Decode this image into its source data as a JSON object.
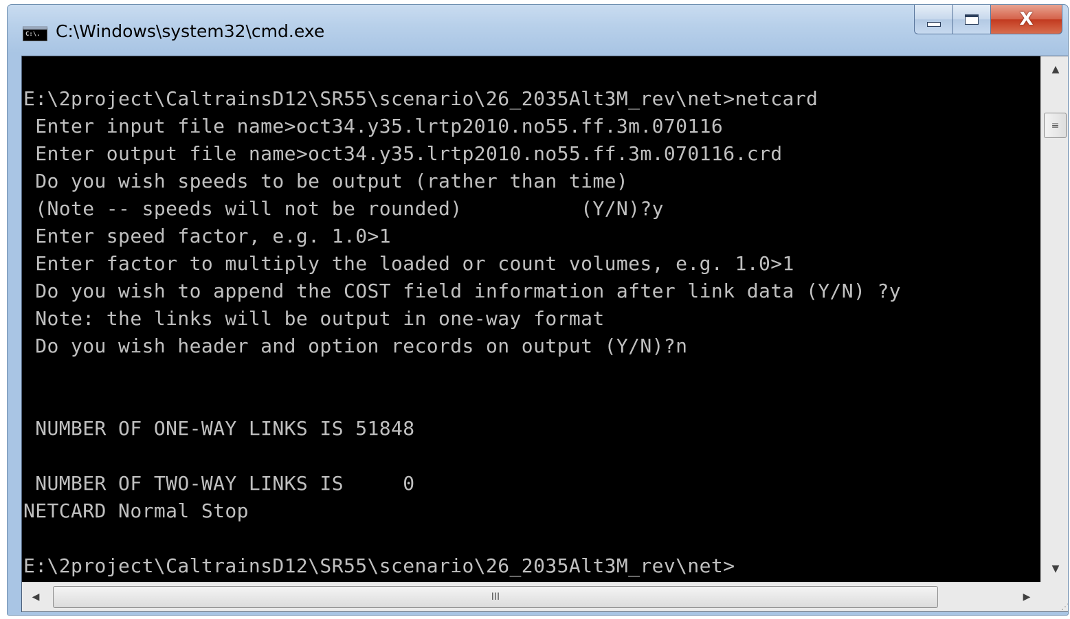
{
  "window": {
    "title": "C:\\Windows\\system32\\cmd.exe",
    "icon_text": "C:\\.",
    "icons": {
      "app": "cmd-prompt-icon",
      "minimize": "minimize-icon",
      "maximize": "maximize-icon",
      "close": "close-icon"
    },
    "close_glyph": "X"
  },
  "console": {
    "background": "#000000",
    "foreground": "#c0c0c0",
    "lines": [
      "E:\\2project\\CaltrainsD12\\SR55\\scenario\\26_2035Alt3M_rev\\net>netcard",
      " Enter input file name>oct34.y35.lrtp2010.no55.ff.3m.070116",
      " Enter output file name>oct34.y35.lrtp2010.no55.ff.3m.070116.crd",
      " Do you wish speeds to be output (rather than time)",
      " (Note -- speeds will not be rounded)          (Y/N)?y",
      " Enter speed factor, e.g. 1.0>1",
      " Enter factor to multiply the loaded or count volumes, e.g. 1.0>1",
      " Do you wish to append the COST field information after link data (Y/N) ?y",
      " Note: the links will be output in one-way format",
      " Do you wish header and option records on output (Y/N)?n",
      "",
      "",
      " NUMBER OF ONE-WAY LINKS IS 51848",
      "",
      " NUMBER OF TWO-WAY LINKS IS     0",
      "NETCARD Normal Stop",
      "",
      "E:\\2project\\CaltrainsD12\\SR55\\scenario\\26_2035Alt3M_rev\\net>"
    ]
  },
  "scrollbars": {
    "vertical": {
      "up_icon": "scroll-up-arrow-icon",
      "down_icon": "scroll-down-arrow-icon",
      "up_glyph": "▲",
      "down_glyph": "▼",
      "thumb_grip": "≡"
    },
    "horizontal": {
      "left_icon": "scroll-left-arrow-icon",
      "right_icon": "scroll-right-arrow-icon",
      "left_glyph": "◀",
      "right_glyph": "▶",
      "thumb_grip": "III"
    },
    "corner_grip": "⋰"
  }
}
